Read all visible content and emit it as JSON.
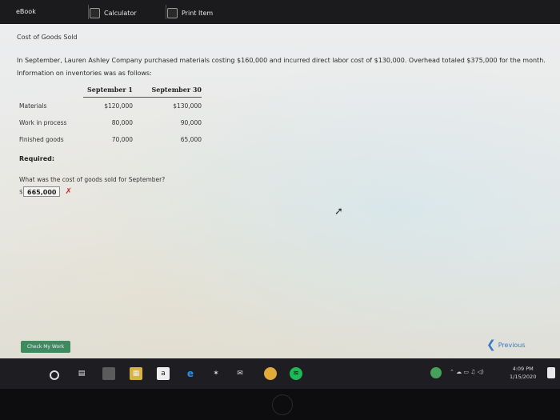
{
  "toolbar": {
    "ebook_label": "eBook",
    "calculator_label": "Calculator",
    "print_label": "Print Item"
  },
  "page": {
    "title": "Cost of Goods Sold",
    "problem_text": "In September, Lauren Ashley Company purchased materials costing $160,000 and incurred direct labor cost of $130,000. Overhead totaled $375,000 for the month. Information on inventories was as follows:",
    "table": {
      "headers": [
        "September 1",
        "September 30"
      ],
      "rows": [
        {
          "label": "Materials",
          "sep1": "$120,000",
          "sep30": "$130,000"
        },
        {
          "label": "Work in process",
          "sep1": "80,000",
          "sep30": "90,000"
        },
        {
          "label": "Finished goods",
          "sep1": "70,000",
          "sep30": "65,000"
        }
      ]
    },
    "required_label": "Required:",
    "question": "What was the cost of goods sold for September?",
    "answer": {
      "currency": "$",
      "value": "665,000",
      "status_mark": "✗"
    },
    "check_button": "Check My Work",
    "previous_label": "Previous"
  },
  "taskbar": {
    "time": "4:09 PM",
    "date": "1/15/2020"
  },
  "colors": {
    "error": "#d12a2a",
    "check_button": "#3f8a5e",
    "link": "#3a79c8"
  },
  "icons": [
    "calculator-icon",
    "print-icon",
    "chevron-left-icon",
    "windows-search-icon",
    "task-view-icon",
    "edge-icon",
    "file-explorer-icon",
    "store-icon",
    "chrome-icon",
    "spotify-icon",
    "mail-icon"
  ]
}
